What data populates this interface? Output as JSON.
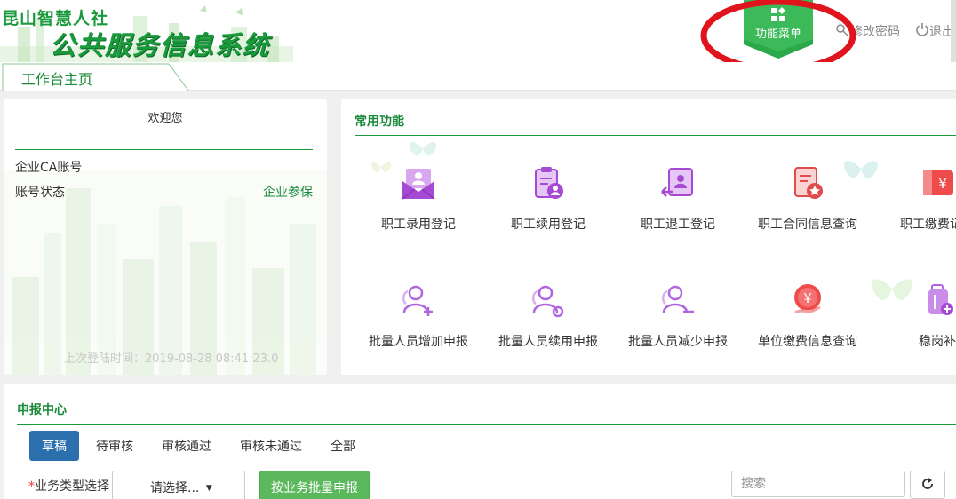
{
  "header": {
    "logo_line1": "昆山智慧人社",
    "logo_line2": "公共服务信息系统",
    "menu_button": "功能菜单",
    "change_password": "修改密码",
    "logout": "退出"
  },
  "tabs": {
    "home": "工作台主页"
  },
  "welcome_panel": {
    "welcome": "欢迎您",
    "ca_account_label": "企业CA账号",
    "account_status_label": "账号状态",
    "account_status_value": "企业参保",
    "last_login": "上次登陆时间：2019-08-28 08:41:23.0"
  },
  "common_functions": {
    "title": "常用功能",
    "items": [
      {
        "label": "职工录用登记",
        "icon": "mail-user-icon"
      },
      {
        "label": "职工续用登记",
        "icon": "clipboard-user-icon"
      },
      {
        "label": "职工退工登记",
        "icon": "user-return-icon"
      },
      {
        "label": "职工合同信息查询",
        "icon": "contract-badge-icon"
      },
      {
        "label": "职工缴费记录",
        "icon": "yen-card-icon"
      },
      {
        "label": "批量人员增加申报",
        "icon": "users-plus-icon"
      },
      {
        "label": "批量人员续用申报",
        "icon": "users-refresh-icon"
      },
      {
        "label": "批量人员减少申报",
        "icon": "user-minus-icon"
      },
      {
        "label": "单位缴费信息查询",
        "icon": "yen-hand-icon"
      },
      {
        "label": "稳岗补",
        "icon": "suitcase-plus-icon"
      }
    ]
  },
  "declaration_center": {
    "title": "申报中心",
    "filters": [
      "草稿",
      "待审核",
      "审核通过",
      "审核未通过",
      "全部"
    ],
    "active_filter": "草稿",
    "business_type_label": "业务类型选择",
    "required_mark": "*",
    "select_placeholder": "请选择...",
    "batch_button": "按业务批量申报",
    "search_placeholder": "搜索"
  },
  "colors": {
    "brand_green": "#1a9a3c",
    "active_tab": "#2c6fad",
    "batch_button": "#5cb85c",
    "annotation_red": "#e0141c"
  }
}
